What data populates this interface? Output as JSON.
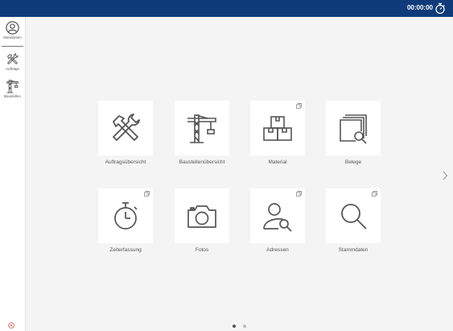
{
  "header": {
    "timer": "00:00:00",
    "timer_icon": "stopwatch-icon",
    "background_color": "#0f3b7a"
  },
  "sidebar": {
    "items": [
      {
        "label": "Mandanten",
        "icon": "user-circle-icon",
        "active": true
      },
      {
        "label": "Aufträge",
        "icon": "tools-icon",
        "active": false
      },
      {
        "label": "Baustellen",
        "icon": "crane-icon",
        "active": false
      }
    ],
    "bottom_icon": "close-circle-icon"
  },
  "tiles": [
    {
      "label": "Auftragsübersicht",
      "icon": "tools-icon",
      "badge": false
    },
    {
      "label": "Baustellenübersicht",
      "icon": "crane-icon",
      "badge": false
    },
    {
      "label": "Material",
      "icon": "boxes-icon",
      "badge": true
    },
    {
      "label": "Belege",
      "icon": "documents-search-icon",
      "badge": false
    },
    {
      "label": "Zeiterfassung",
      "icon": "stopwatch-icon",
      "badge": true
    },
    {
      "label": "Fotos",
      "icon": "camera-icon",
      "badge": false
    },
    {
      "label": "Adressen",
      "icon": "person-search-icon",
      "badge": true
    },
    {
      "label": "Stammdaten",
      "icon": "search-icon",
      "badge": true
    }
  ],
  "pagination": {
    "pages": 2,
    "current": 1
  },
  "colors": {
    "icon": "#555555",
    "dot_active": "#555555",
    "dot_inactive": "#bbbbbb"
  }
}
